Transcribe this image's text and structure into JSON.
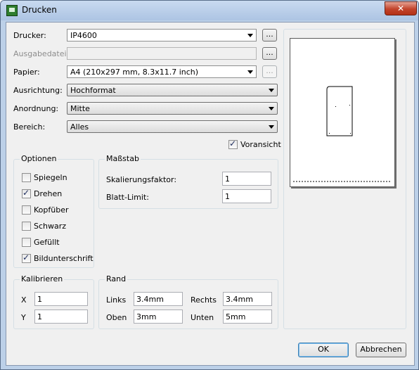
{
  "window": {
    "title": "Drucken",
    "close_label": "✕"
  },
  "form": {
    "drucker": {
      "label": "Drucker:",
      "value": "IP4600",
      "browse": "..."
    },
    "ausgabedatei": {
      "label": "Ausgabedatei:",
      "value": "",
      "browse": "..."
    },
    "papier": {
      "label": "Papier:",
      "value": "A4 (210x297 mm, 8.3x11.7 inch)",
      "browse": "..."
    },
    "ausrichtung": {
      "label": "Ausrichtung:",
      "value": "Hochformat"
    },
    "anordnung": {
      "label": "Anordnung:",
      "value": "Mitte"
    },
    "bereich": {
      "label": "Bereich:",
      "value": "Alles"
    },
    "voransicht": {
      "label": "Voransicht",
      "checked": true
    }
  },
  "optionen": {
    "title": "Optionen",
    "items": [
      {
        "label": "Spiegeln",
        "checked": false
      },
      {
        "label": "Drehen",
        "checked": true
      },
      {
        "label": "Kopfüber",
        "checked": false
      },
      {
        "label": "Schwarz",
        "checked": false
      },
      {
        "label": "Gefüllt",
        "checked": false
      },
      {
        "label": "Bildunterschrift",
        "checked": true
      }
    ]
  },
  "massstab": {
    "title": "Maßstab",
    "skalierung": {
      "label": "Skalierungsfaktor:",
      "value": "1"
    },
    "blattlimit": {
      "label": "Blatt-Limit:",
      "value": "1"
    }
  },
  "kalibrieren": {
    "title": "Kalibrieren",
    "x": {
      "label": "X",
      "value": "1"
    },
    "y": {
      "label": "Y",
      "value": "1"
    }
  },
  "rand": {
    "title": "Rand",
    "links": {
      "label": "Links",
      "value": "3.4mm"
    },
    "rechts": {
      "label": "Rechts",
      "value": "3.4mm"
    },
    "oben": {
      "label": "Oben",
      "value": "3mm"
    },
    "unten": {
      "label": "Unten",
      "value": "5mm"
    }
  },
  "buttons": {
    "ok": "OK",
    "cancel": "Abbrechen"
  }
}
